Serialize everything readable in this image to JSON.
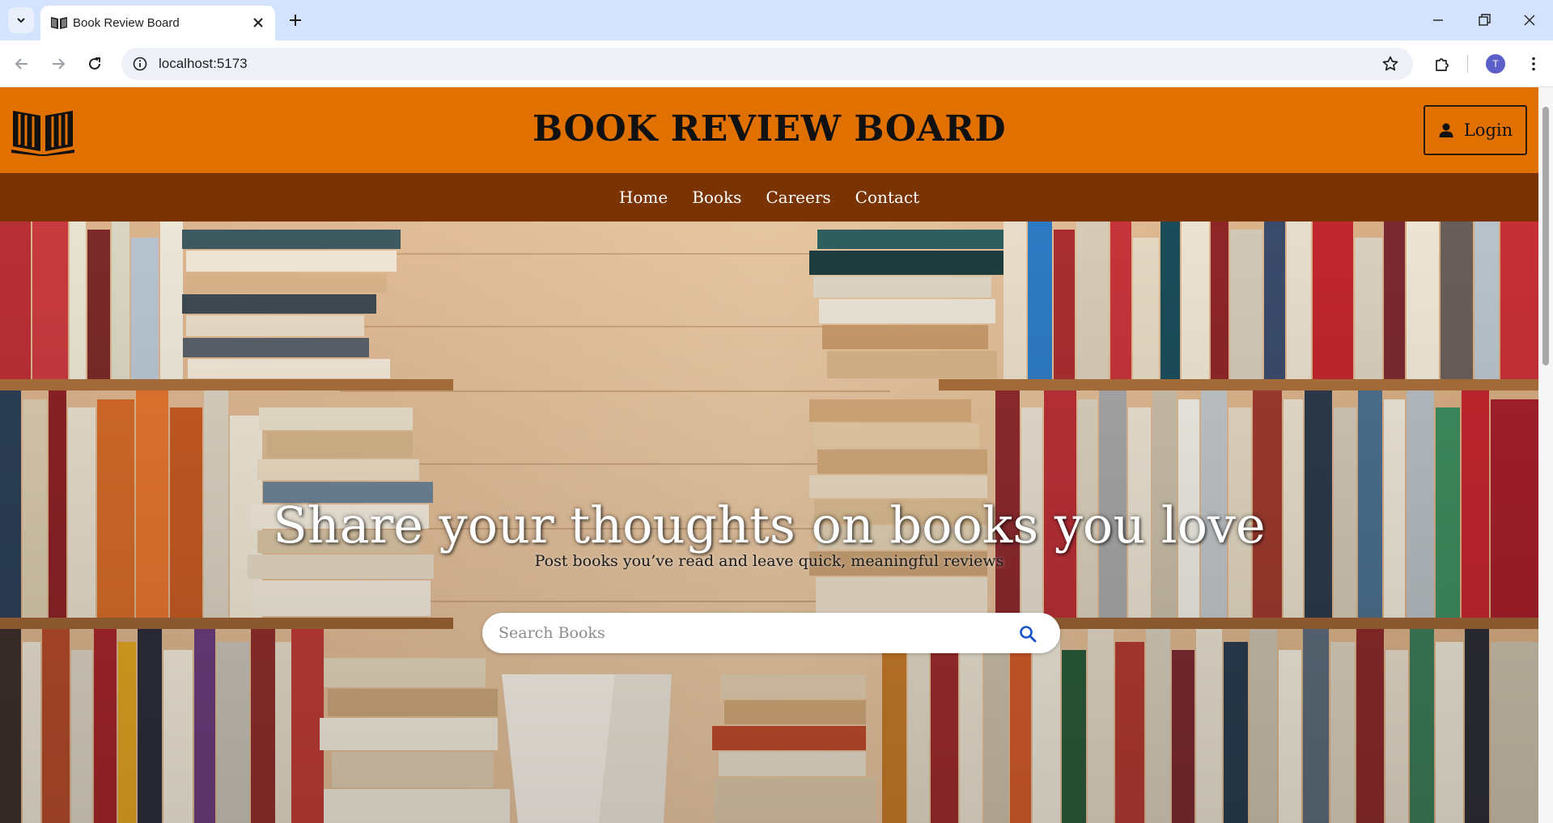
{
  "browser": {
    "tab_title": "Book Review Board",
    "url": "localhost:5173",
    "profile_initial": "T"
  },
  "site": {
    "title": "BOOK REVIEW BOARD",
    "login_label": "Login",
    "nav": [
      "Home",
      "Books",
      "Careers",
      "Contact"
    ],
    "hero_title": "Share your thoughts on books you love",
    "hero_subtitle": "Post books you’ve read and leave quick, meaningful reviews",
    "search_placeholder": "Search Books"
  },
  "colors": {
    "header_orange": "#e07000",
    "nav_brown": "#7a3404",
    "search_icon_blue": "#1a56c8"
  },
  "icons": {
    "logo": "open-book-icon",
    "login": "user-icon",
    "search": "magnifier-icon"
  }
}
